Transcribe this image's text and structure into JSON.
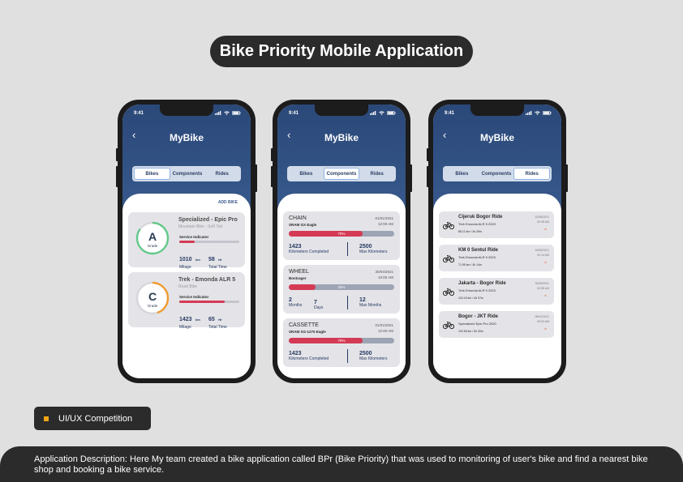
{
  "title": "Bike Priority Mobile Application",
  "status_time": "9:41",
  "app_title": "MyBike",
  "tabs": [
    "Bikes",
    "Components",
    "Rides"
  ],
  "colors": {
    "accent_red": "#d43a55",
    "header_blue": "#2a4878",
    "grade_a_green": "#64c98a",
    "grade_c_orange": "#f29b2f",
    "ride_arrow": "#e0582f"
  },
  "bikes_screen": {
    "add_bike": "ADD BIKE",
    "service_label": "Service Indicator",
    "bikes": [
      {
        "grade": "A",
        "grade_label": "Grade",
        "grade_level": 0.85,
        "name": "Specialized - Epic Pro",
        "type": "Mountain Bike - Soft Tail",
        "service_level": 0.25,
        "mileage": "1010",
        "mileage_unit": "km",
        "mileage_label": "Milage",
        "time": "58",
        "time_unit": "Hr",
        "time_label": "Total Time"
      },
      {
        "grade": "C",
        "grade_label": "Grade",
        "grade_level": 0.45,
        "name": "Trek - Emonda ALR 5",
        "type": "Road Bike",
        "service_level": 0.75,
        "mileage": "1423",
        "mileage_unit": "km",
        "mileage_label": "Milage",
        "time": "65",
        "time_unit": "Hr",
        "time_label": "Total Time"
      }
    ]
  },
  "components_screen": {
    "components": [
      {
        "name": "CHAIN",
        "model": "SRAM GX Eagle",
        "date": "01/01/2021",
        "time": "12:00 AM",
        "percent_label": "70%",
        "level": 0.7,
        "left_value": "1423",
        "left_label": "Kilometers Completed",
        "right_value": "2500",
        "right_label": "Max Kilometers"
      },
      {
        "name": "WHEEL",
        "model": "Bontrager",
        "date": "30/04/2021",
        "time": "10:00 AM",
        "percent_label": "20%",
        "level": 0.25,
        "left_value": "2",
        "left_label": "Months",
        "mid_value": "7",
        "mid_label": "Days",
        "right_value": "12",
        "right_label": "Max Months"
      },
      {
        "name": "CASSETTE",
        "model": "SRAM XG-1275 Eagle",
        "date": "01/01/2021",
        "time": "12:00 AM",
        "percent_label": "70%",
        "level": 0.7,
        "left_value": "1423",
        "left_label": "Kilometers Completed",
        "right_value": "2500",
        "right_label": "Max Kilometers"
      }
    ]
  },
  "rides_screen": {
    "rides": [
      {
        "name": "Cijeruk Bogor Ride",
        "bike": "Trek Emonda ALR 5 2023",
        "stats": "85.12 km / 4h 25m",
        "date": "22/05/2021",
        "time": "00:45 AM"
      },
      {
        "name": "KM 0 Sentul Ride",
        "bike": "Trek Emonda ALR 5 2023",
        "stats": "71.95 km / 4h 14m",
        "date": "15/05/2021",
        "time": "00:14 AM"
      },
      {
        "name": "Jakarta - Bogor Ride",
        "bike": "Trek Emonda ALR 5 2023",
        "stats": "102.43 km / 4h 57m",
        "date": "18/05/2021",
        "time": "00:55 AM"
      },
      {
        "name": "Bogor - JKT Ride",
        "bike": "Specialized Epic Pro 2020",
        "stats": "102.55 km / 5h 30m",
        "date": "08/02/2021",
        "time": "05:53 AM"
      }
    ]
  },
  "badge": "UI/UX Competition",
  "description": "Application Description: Here My team created a bike application called BPr (Bike Priority) that was used to monitoring of user's bike and find a nearest bike shop and booking a bike service."
}
